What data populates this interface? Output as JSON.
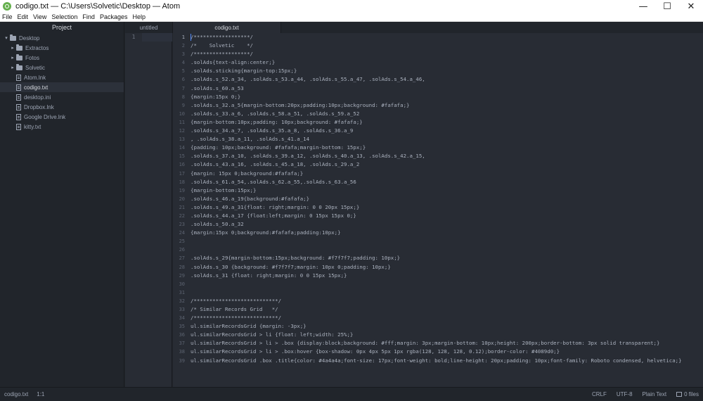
{
  "window": {
    "title": "codigo.txt — C:\\Users\\Solvetic\\Desktop — Atom",
    "minimize": "—",
    "maximize": "☐",
    "close": "✕"
  },
  "menu": [
    "File",
    "Edit",
    "View",
    "Selection",
    "Find",
    "Packages",
    "Help"
  ],
  "tree": {
    "header": "Project",
    "root": "Desktop",
    "folders": [
      "Extractos",
      "Fotos",
      "Solvetic"
    ],
    "files": [
      "Atom.lnk",
      "codigo.txt",
      "desktop.ini",
      "Dropbox.lnk",
      "Google Drive.lnk",
      "kitty.txt"
    ],
    "selected": "codigo.txt"
  },
  "tabs": [
    {
      "label": "untitled",
      "active": false
    },
    {
      "label": "codigo.txt",
      "active": true
    }
  ],
  "untitled_pane": {
    "line_numbers": [
      "1"
    ]
  },
  "editor": {
    "cursor_line": 1,
    "lines": [
      "/******************/",
      "/*    Solvetic    */",
      "/******************/",
      ".solAds{text-align:center;}",
      ".solAds.sticking{margin-top:15px;}",
      ".solAds.s_52.a_34, .solAds.s_53.a_44, .solAds.s_55.a_47, .solAds.s_54.a_46,",
      ".solAds.s_60.a_53",
      "{margin:15px 0;}",
      ".solAds.s_32.a_5{margin-bottom:20px;padding:10px;background: #fafafa;}",
      ".solAds.s_33.a_6, .solAds.s_58.a_51, .solAds.s_59.a_52",
      "{margin-bottom:10px;padding: 10px;background: #fafafa;}",
      ".solAds.s_34.a_7, .solAds.s_35.a_8, .solAds.s_36.a_9",
      ", .solAds.s_38.a_11, .solAds.s_41.a_14",
      "{padding: 10px;background: #fafafa;margin-bottom: 15px;}",
      ".solAds.s_37.a_10, .solAds.s_39.a_12, .solAds.s_40.a_13, .solAds.s_42.a_15,",
      ".solAds.s_43.a_16, .solAds.s_45.a_18, .solAds.s_29.a_2",
      "{margin: 15px 0;background:#fafafa;}",
      ".solAds.s_61.a_54,.solAds.s_62.a_55,.solAds.s_63.a_56",
      "{margin-bottom:15px;}",
      ".solAds.s_46.a_19{background:#fafafa;}",
      ".solAds.s_49.a_31{float: right;margin: 0 0 20px 15px;}",
      ".solAds.s_44.a_17 {float:left;margin: 0 15px 15px 0;}",
      ".solAds.s_50.a_32",
      "{margin:15px 0;background:#fafafa;padding:10px;}",
      "",
      "",
      ".solAds.s_29{margin-bottom:15px;background: #f7f7f7;padding: 10px;}",
      ".solAds.s_30 {background: #f7f7f7;margin: 10px 0;padding: 10px;}",
      ".solAds.s_31 {float: right;margin: 0 0 15px 15px;}",
      "",
      "",
      "/***************************/",
      "/* Similar Records Grid   */",
      "/***************************/",
      "ul.similarRecordsGrid {margin: -3px;}",
      "ul.similarRecordsGrid > li {float: left;width: 25%;}",
      "ul.similarRecordsGrid > li > .box {display:block;background: #fff;margin: 3px;margin-bottom: 10px;height: 200px;border-bottom: 3px solid transparent;}",
      "ul.similarRecordsGrid > li > .box:hover {box-shadow: 0px 4px 5px 1px rgba(128, 128, 128, 0.12);border-color: #4089d0;}",
      "ul.similarRecordsGrid .box .title{color: #4a4a4a;font-size: 17px;font-weight: bold;line-height: 20px;padding: 10px;font-family: Roboto condensed, helvetica;}"
    ]
  },
  "status": {
    "file": "codigo.txt",
    "position": "1:1",
    "line_ending": "CRLF",
    "encoding": "UTF-8",
    "grammar": "Plain Text",
    "files": "0 files"
  }
}
